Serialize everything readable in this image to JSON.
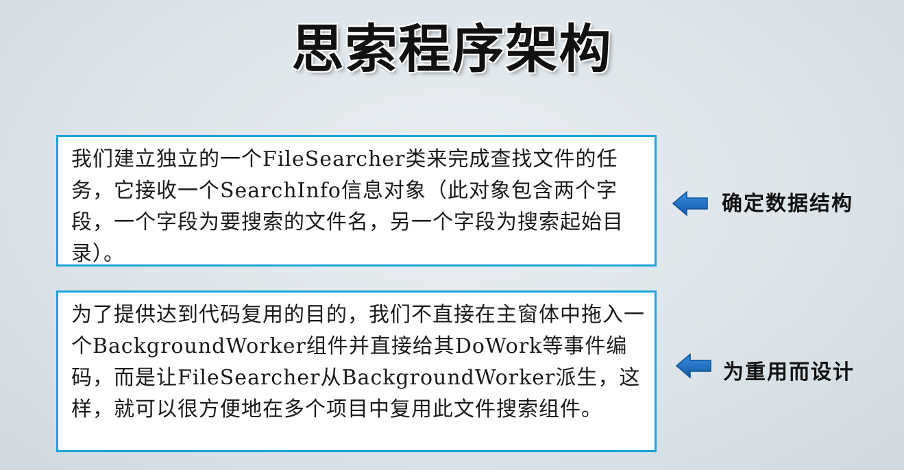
{
  "slide": {
    "title": "思索程序架构"
  },
  "blocks": [
    {
      "text": "我们建立独立的一个FileSearcher类来完成查找文件的任务，它接收一个SearchInfo信息对象（此对象包含两个字段，一个字段为要搜索的文件名，另一个字段为搜索起始目录）。",
      "note": "确定数据结构",
      "icon": "left-arrow-icon"
    },
    {
      "text": "为了提供达到代码复用的目的，我们不直接在主窗体中拖入一个BackgroundWorker组件并直接给其DoWork等事件编码，而是让FileSearcher从BackgroundWorker派生，这样，就可以很方便地在多个项目中复用此文件搜索组件。",
      "note": "为重用而设计",
      "icon": "left-arrow-icon"
    }
  ],
  "colors": {
    "box_border": "#1aa3db",
    "arrow_fill": "#1f6fc6",
    "background": "#dde5ea"
  }
}
